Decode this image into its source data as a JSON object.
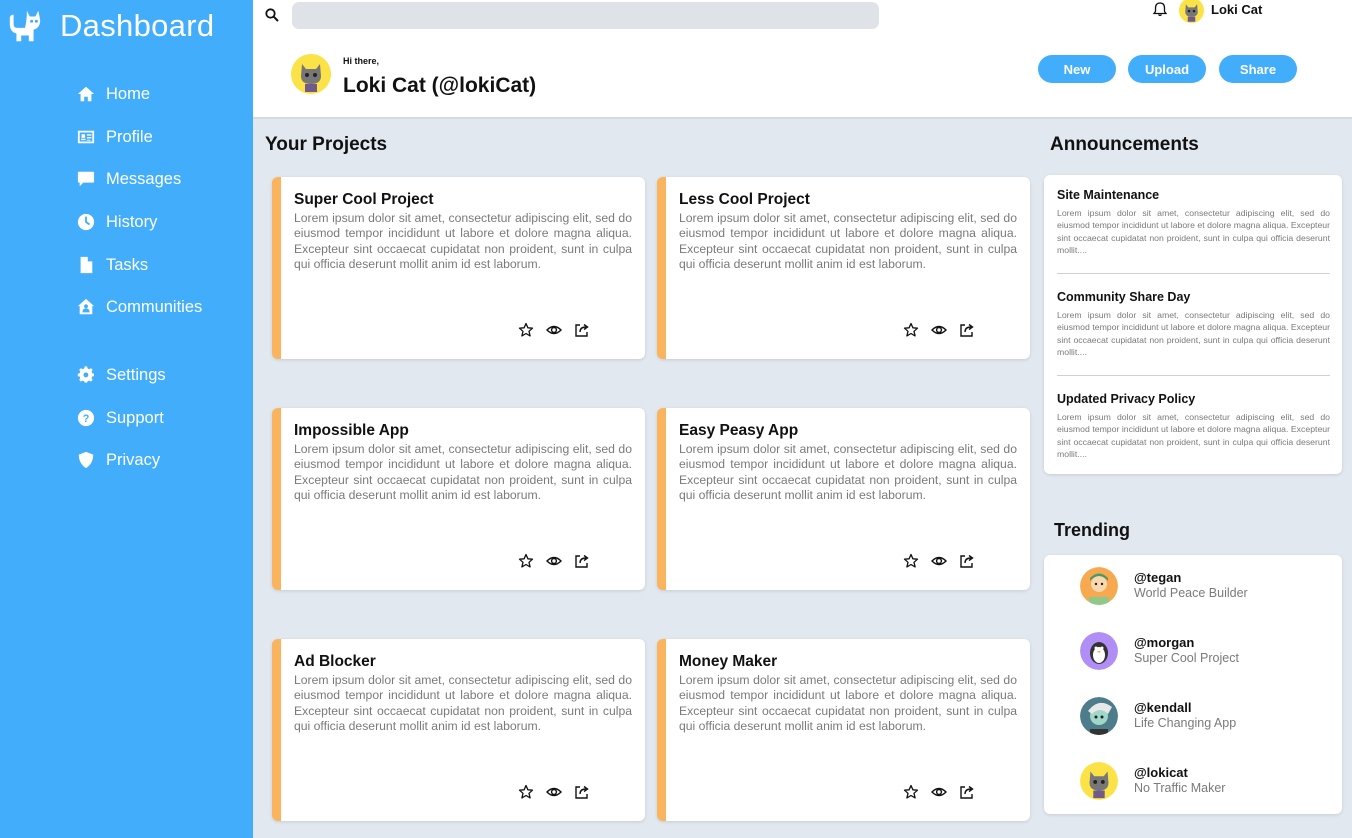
{
  "sidebar": {
    "brand": "Dashboard",
    "items": [
      {
        "label": "Home",
        "icon": "home-icon"
      },
      {
        "label": "Profile",
        "icon": "profile-card-icon"
      },
      {
        "label": "Messages",
        "icon": "message-icon"
      },
      {
        "label": "History",
        "icon": "clock-icon"
      },
      {
        "label": "Tasks",
        "icon": "document-icon"
      },
      {
        "label": "Communities",
        "icon": "house-user-icon"
      },
      {
        "label": "Settings",
        "icon": "gear-icon"
      },
      {
        "label": "Support",
        "icon": "question-icon"
      },
      {
        "label": "Privacy",
        "icon": "shield-icon"
      }
    ]
  },
  "topbar": {
    "search_placeholder": "",
    "user_name": "Loki Cat",
    "greeting": "Hi there,",
    "display_name": "Loki Cat (@lokiCat)",
    "buttons": {
      "new": "New",
      "upload": "Upload",
      "share": "Share"
    }
  },
  "projects": {
    "title": "Your Projects",
    "items": [
      {
        "title": "Super Cool Project",
        "desc": "Lorem ipsum dolor sit amet, consectetur adipiscing elit, sed do eiusmod tempor incididunt ut labore et dolore magna aliqua. Excepteur sint occaecat cupidatat non proident, sunt in culpa qui officia deserunt mollit anim id est laborum."
      },
      {
        "title": "Less Cool Project",
        "desc": "Lorem ipsum dolor sit amet, consectetur adipiscing elit, sed do eiusmod tempor incididunt ut labore et dolore magna aliqua. Excepteur sint occaecat cupidatat non proident, sunt in culpa qui officia deserunt mollit anim id est laborum."
      },
      {
        "title": "Impossible App",
        "desc": "Lorem ipsum dolor sit amet, consectetur adipiscing elit, sed do eiusmod tempor incididunt ut labore et dolore magna aliqua. Excepteur sint occaecat cupidatat non proident, sunt in culpa qui officia deserunt mollit anim id est laborum."
      },
      {
        "title": "Easy Peasy App",
        "desc": "Lorem ipsum dolor sit amet, consectetur adipiscing elit, sed do eiusmod tempor incididunt ut labore et dolore magna aliqua. Excepteur sint occaecat cupidatat non proident, sunt in culpa qui officia deserunt mollit anim id est laborum."
      },
      {
        "title": "Ad Blocker",
        "desc": "Lorem ipsum dolor sit amet, consectetur adipiscing elit, sed do eiusmod tempor incididunt ut labore et dolore magna aliqua. Excepteur sint occaecat cupidatat non proident, sunt in culpa qui officia deserunt mollit anim id est laborum."
      },
      {
        "title": "Money Maker",
        "desc": "Lorem ipsum dolor sit amet, consectetur adipiscing elit, sed do eiusmod tempor incididunt ut labore et dolore magna aliqua. Excepteur sint occaecat cupidatat non proident, sunt in culpa qui officia deserunt mollit anim id est laborum."
      }
    ]
  },
  "announcements": {
    "title": "Announcements",
    "items": [
      {
        "title": "Site Maintenance",
        "body": "Lorem ipsum dolor sit amet, consectetur adipiscing elit, sed do eiusmod tempor incididunt ut labore et dolore magna aliqua. Excepteur sint occaecat cupidatat non proident, sunt in culpa qui officia deserunt mollit...."
      },
      {
        "title": "Community Share Day",
        "body": "Lorem ipsum dolor sit amet, consectetur adipiscing elit, sed do eiusmod tempor incididunt ut labore et dolore magna aliqua. Excepteur sint occaecat cupidatat non proident, sunt in culpa qui officia deserunt mollit...."
      },
      {
        "title": "Updated Privacy Policy",
        "body": "Lorem ipsum dolor sit amet, consectetur adipiscing elit, sed do eiusmod tempor incididunt ut labore et dolore magna aliqua. Excepteur sint occaecat cupidatat non proident, sunt in culpa qui officia deserunt mollit...."
      }
    ]
  },
  "trending": {
    "title": "Trending",
    "items": [
      {
        "handle": "@tegan",
        "subtitle": "World Peace Builder",
        "avatar_color": "#f6a94f"
      },
      {
        "handle": "@morgan",
        "subtitle": "Super Cool Project",
        "avatar_color": "#b08ef5"
      },
      {
        "handle": "@kendall",
        "subtitle": "Life Changing App",
        "avatar_color": "#4d7d8a"
      },
      {
        "handle": "@lokicat",
        "subtitle": "No Traffic Maker",
        "avatar_color": "#fbe347"
      }
    ]
  },
  "colors": {
    "accent": "#42adfb",
    "card_stripe": "#fbb45e",
    "background": "#e2e8f0"
  }
}
